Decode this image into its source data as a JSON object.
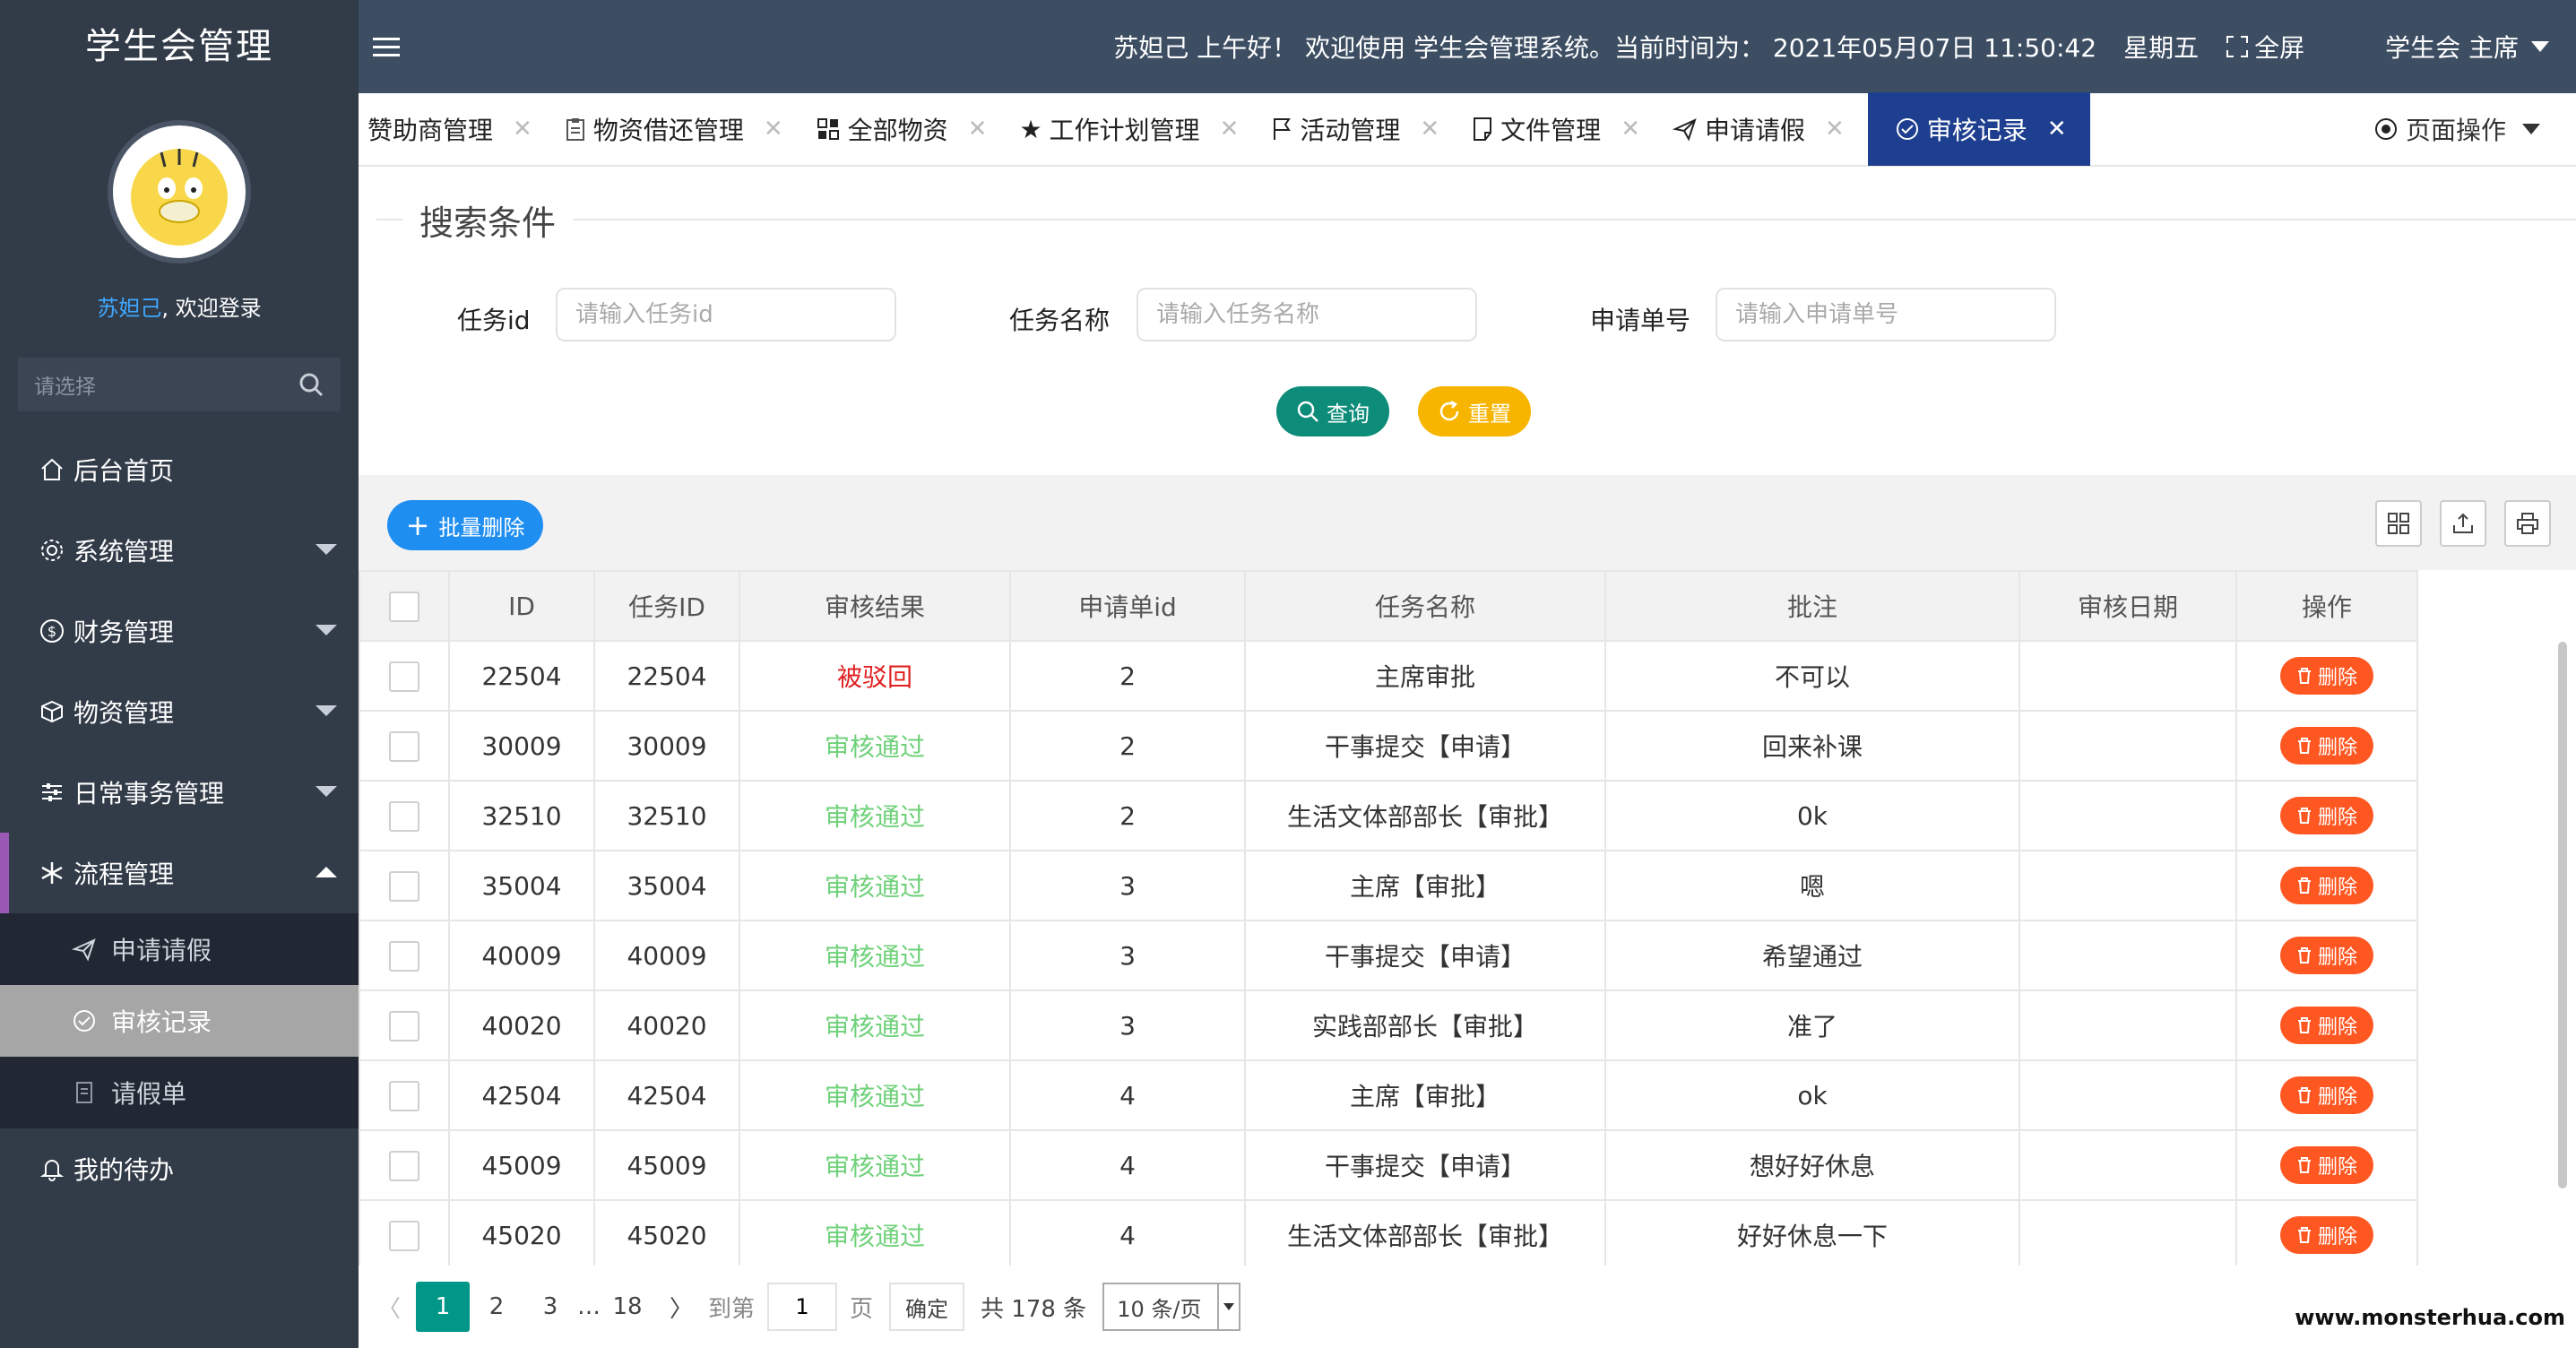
{
  "sidebar": {
    "app_title": "学生会管理",
    "welcome_name": "苏妲己",
    "welcome_suffix": ", 欢迎登录",
    "search_placeholder": "请选择",
    "menu": [
      {
        "label": "后台首页",
        "icon": "home-icon"
      },
      {
        "label": "系统管理",
        "icon": "gear-icon"
      },
      {
        "label": "财务管理",
        "icon": "dollar-icon"
      },
      {
        "label": "物资管理",
        "icon": "box-icon"
      },
      {
        "label": "日常事务管理",
        "icon": "sliders-icon"
      },
      {
        "label": "流程管理",
        "icon": "snowflake-icon"
      }
    ],
    "sub_menu": [
      {
        "label": "申请请假",
        "icon": "send-icon"
      },
      {
        "label": "审核记录",
        "icon": "check-circle-icon"
      },
      {
        "label": "请假单",
        "icon": "document-icon"
      }
    ],
    "last_item": {
      "label": "我的待办",
      "icon": "bell-icon"
    }
  },
  "header": {
    "greeting": "苏妲己 上午好！ 欢迎使用 学生会管理系统。当前时间为： 2021年05月07日 11:50:42",
    "weekday": "星期五",
    "fullscreen_label": "全屏",
    "user_label": "学生会 主席"
  },
  "tabs": [
    {
      "label": "赞助商管理",
      "icon": ""
    },
    {
      "label": "物资借还管理",
      "icon": "clipboard-icon"
    },
    {
      "label": "全部物资",
      "icon": "grid-icon"
    },
    {
      "label": "工作计划管理",
      "icon": "star-icon"
    },
    {
      "label": "活动管理",
      "icon": "flag-icon"
    },
    {
      "label": "文件管理",
      "icon": "note-icon"
    },
    {
      "label": "申请请假",
      "icon": "send-icon"
    },
    {
      "label": "审核记录",
      "icon": "check-circle-icon"
    }
  ],
  "page_ops_label": "页面操作",
  "search": {
    "legend": "搜索条件",
    "fields": [
      {
        "label": "任务id",
        "placeholder": "请输入任务id"
      },
      {
        "label": "任务名称",
        "placeholder": "请输入任务名称"
      },
      {
        "label": "申请单号",
        "placeholder": "请输入申请单号"
      }
    ],
    "query_label": "查询",
    "reset_label": "重置"
  },
  "toolbar": {
    "batch_delete_label": "批量删除"
  },
  "table": {
    "columns": [
      "ID",
      "任务ID",
      "审核结果",
      "申请单id",
      "任务名称",
      "批注",
      "审核日期",
      "操作"
    ],
    "delete_label": "删除",
    "rows": [
      {
        "id": "22504",
        "task_id": "22504",
        "result": "被驳回",
        "status": "reject",
        "app_id": "2",
        "task_name": "主席审批",
        "note": "不可以",
        "date": ""
      },
      {
        "id": "30009",
        "task_id": "30009",
        "result": "审核通过",
        "status": "pass",
        "app_id": "2",
        "task_name": "干事提交【申请】",
        "note": "回来补课",
        "date": ""
      },
      {
        "id": "32510",
        "task_id": "32510",
        "result": "审核通过",
        "status": "pass",
        "app_id": "2",
        "task_name": "生活文体部部长【审批】",
        "note": "0k",
        "date": ""
      },
      {
        "id": "35004",
        "task_id": "35004",
        "result": "审核通过",
        "status": "pass",
        "app_id": "3",
        "task_name": "主席【审批】",
        "note": "嗯",
        "date": ""
      },
      {
        "id": "40009",
        "task_id": "40009",
        "result": "审核通过",
        "status": "pass",
        "app_id": "3",
        "task_name": "干事提交【申请】",
        "note": "希望通过",
        "date": ""
      },
      {
        "id": "40020",
        "task_id": "40020",
        "result": "审核通过",
        "status": "pass",
        "app_id": "3",
        "task_name": "实践部部长【审批】",
        "note": "准了",
        "date": ""
      },
      {
        "id": "42504",
        "task_id": "42504",
        "result": "审核通过",
        "status": "pass",
        "app_id": "4",
        "task_name": "主席【审批】",
        "note": "ok",
        "date": ""
      },
      {
        "id": "45009",
        "task_id": "45009",
        "result": "审核通过",
        "status": "pass",
        "app_id": "4",
        "task_name": "干事提交【申请】",
        "note": "想好好休息",
        "date": ""
      },
      {
        "id": "45020",
        "task_id": "45020",
        "result": "审核通过",
        "status": "pass",
        "app_id": "4",
        "task_name": "生活文体部部长【审批】",
        "note": "好好休息一下",
        "date": ""
      }
    ]
  },
  "pagination": {
    "pages": [
      "1",
      "2",
      "3"
    ],
    "ellipsis": "…",
    "last_page": "18",
    "goto_label": "到第",
    "goto_value": "1",
    "page_unit": "页",
    "confirm_label": "确定",
    "total_label": "共 178 条",
    "page_size": "10 条/页"
  },
  "watermark": "www.monsterhua.com",
  "colors": {
    "sidebar_bg": "#323b48",
    "header_bg": "#3d4e63",
    "active_tab": "#1e3f8f",
    "query": "#0d8c7a",
    "reset": "#f7b500",
    "batch": "#1f8ef1",
    "delete": "#ff5722",
    "reject": "#e02020",
    "pass": "#6fd17a"
  }
}
